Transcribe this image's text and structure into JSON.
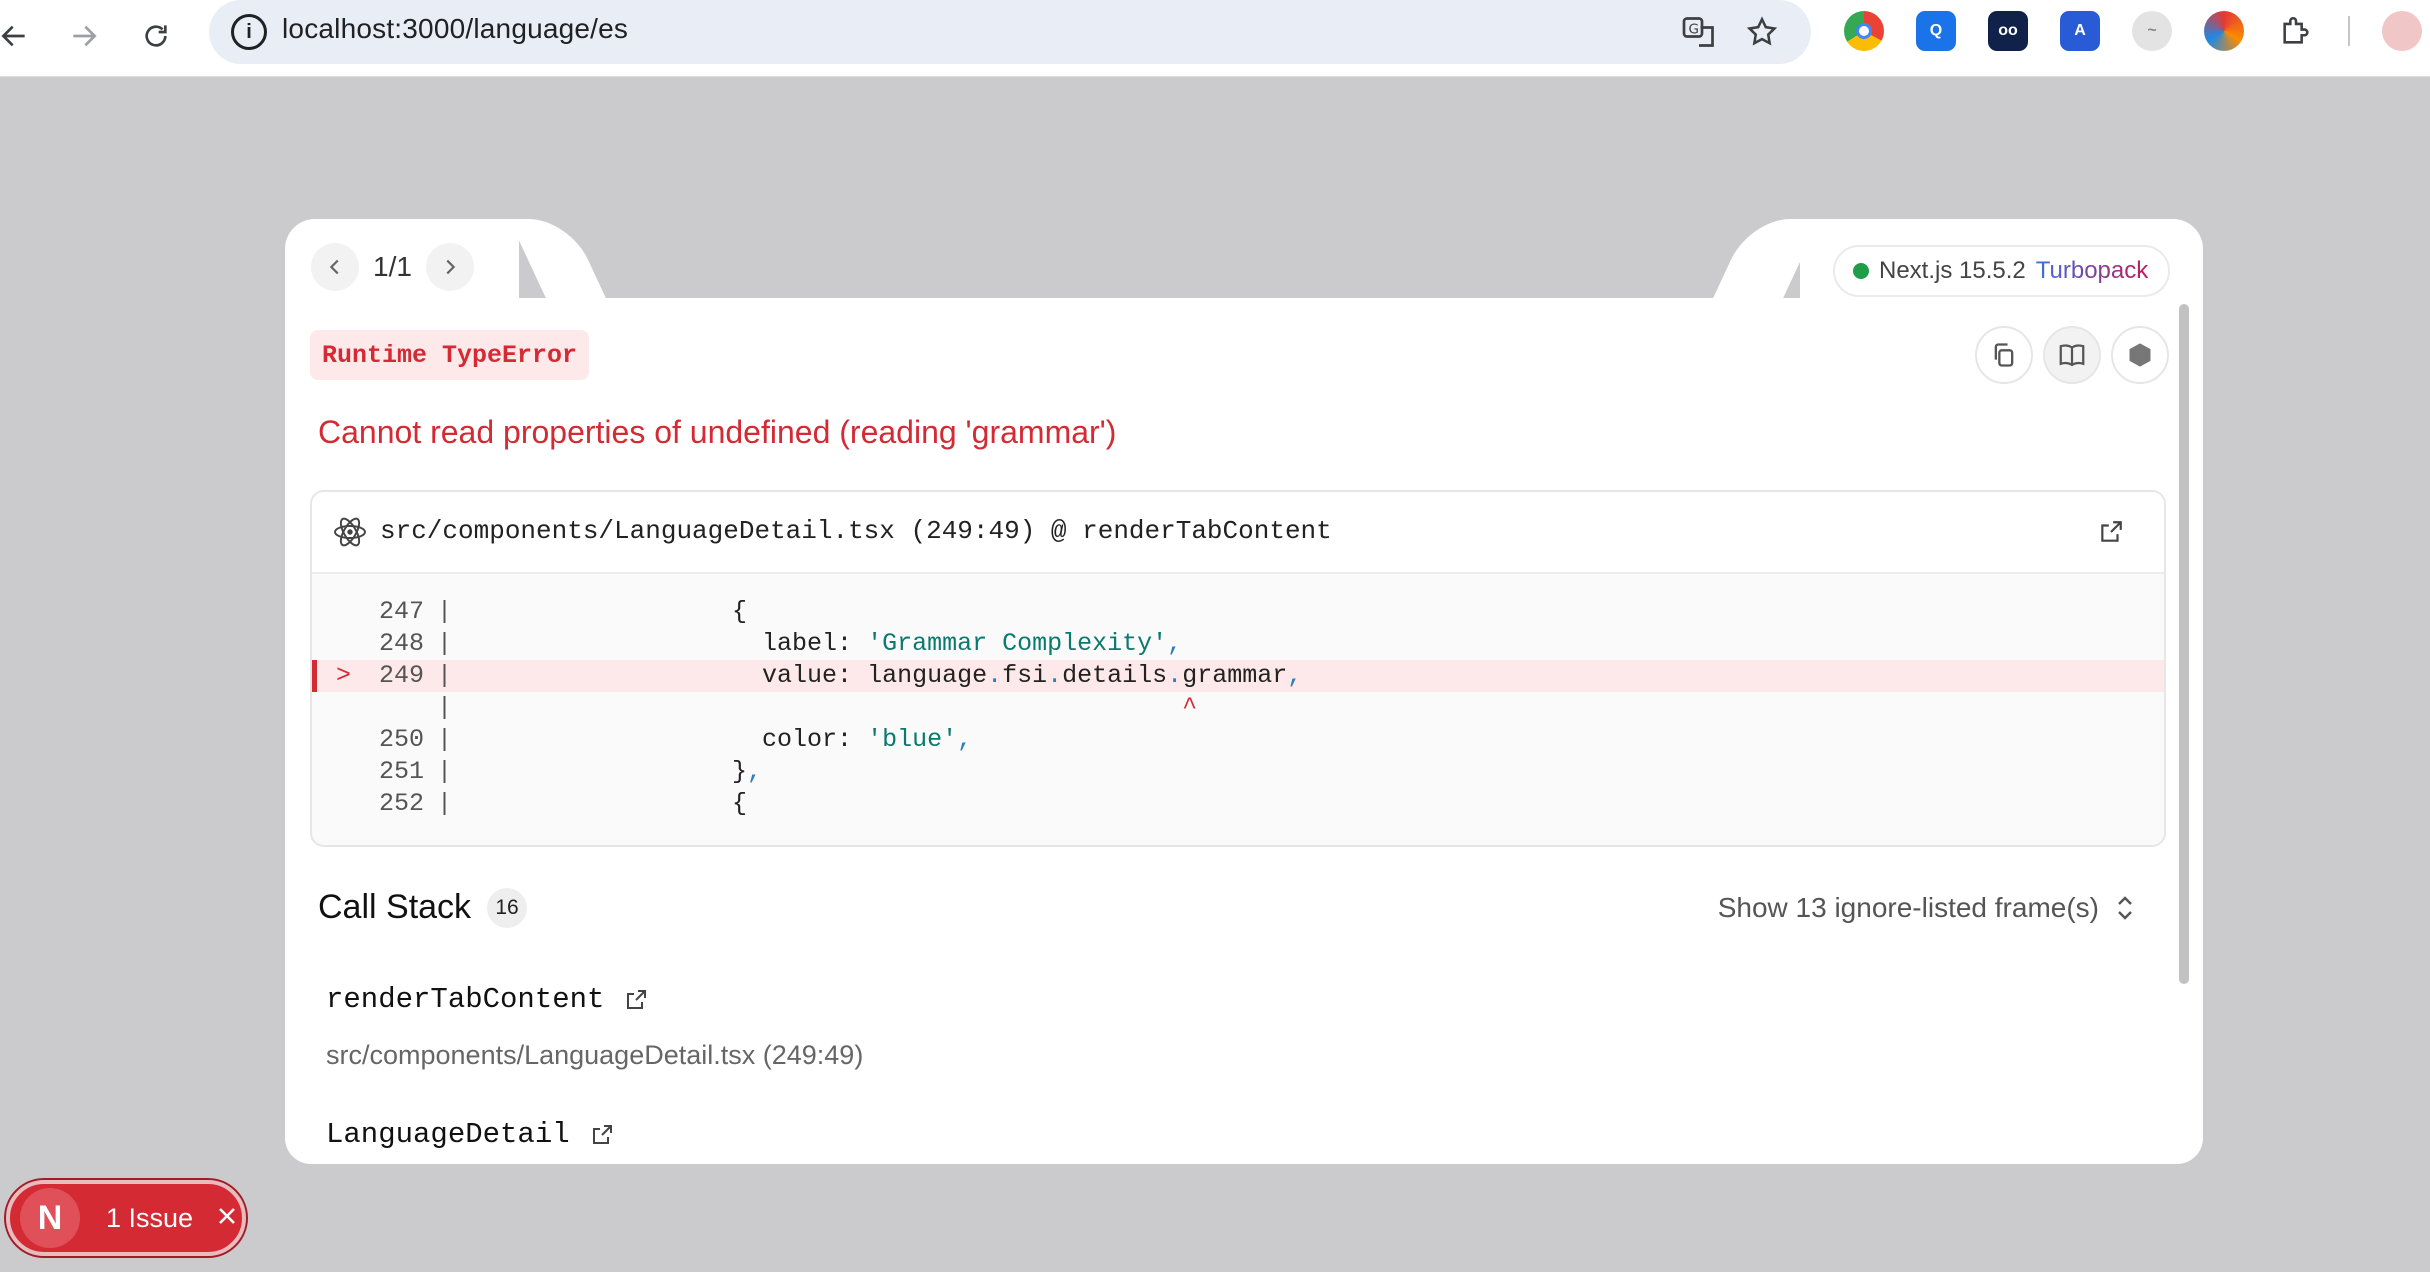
{
  "browser": {
    "url": "localhost:3000/language/es",
    "extensions": [
      "chrome-icon",
      "ext-search-icon",
      "ext-dark-icon",
      "ext-translate-icon",
      "ext-cloud-icon",
      "ext-color-icon",
      "puzzle-icon"
    ]
  },
  "overlay": {
    "pager": "1/1",
    "version_label": "Next.js 15.5.2",
    "bundler": "Turbopack",
    "error_type": "Runtime TypeError",
    "error_message": "Cannot read properties of undefined (reading 'grammar')",
    "code_frame": {
      "location": "src/components/LanguageDetail.tsx (249:49) @ renderTabContent",
      "lines": [
        {
          "num": "247",
          "code": "                  {"
        },
        {
          "num": "248",
          "code": "                    label: 'Grammar Complexity',"
        },
        {
          "num": "249",
          "code": "                    value: language.fsi.details.grammar,",
          "highlight": true,
          "marker": ">"
        },
        {
          "num": "",
          "code": "                                                ^"
        },
        {
          "num": "250",
          "code": "                    color: 'blue',"
        },
        {
          "num": "251",
          "code": "                  },"
        },
        {
          "num": "252",
          "code": "                  {"
        }
      ]
    },
    "call_stack": {
      "title": "Call Stack",
      "count": "16",
      "toggle": "Show 13 ignore-listed frame(s)",
      "frames": [
        {
          "name": "renderTabContent",
          "location": "src/components/LanguageDetail.tsx (249:49)"
        },
        {
          "name": "LanguageDetail",
          "location": ""
        }
      ]
    }
  },
  "issue_badge": {
    "logo": "N",
    "label": "1 Issue"
  },
  "colors": {
    "error_red": "#d42a34",
    "success_green": "#1f9d48",
    "string_teal": "#0b7a6e"
  }
}
